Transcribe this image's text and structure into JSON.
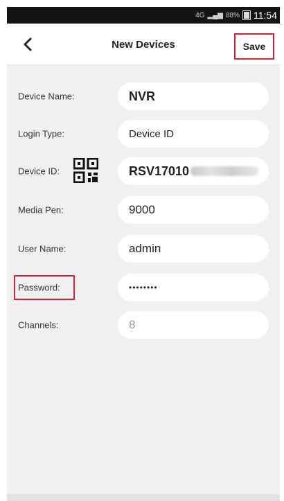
{
  "status_bar": {
    "signal": "4G",
    "battery_pct": "88%",
    "time": "11:54"
  },
  "nav": {
    "back_icon": "chevron-left-icon",
    "title": "New Devices",
    "save_label": "Save",
    "highlight_color": "#c8243a"
  },
  "form": {
    "device_name": {
      "label": "Device Name:",
      "value": "NVR"
    },
    "login_type": {
      "label": "Login Type:",
      "value": "Device ID"
    },
    "device_id": {
      "label": "Device ID:",
      "value": "RSV17010",
      "qr_icon": "qr-code-icon"
    },
    "media_port": {
      "label": "Media Pen:",
      "value": "9000"
    },
    "user_name": {
      "label": "User Name:",
      "value": "admin"
    },
    "password": {
      "label": "Password:",
      "value": "••••••••"
    },
    "channels": {
      "label": "Channels:",
      "value": "8"
    }
  }
}
